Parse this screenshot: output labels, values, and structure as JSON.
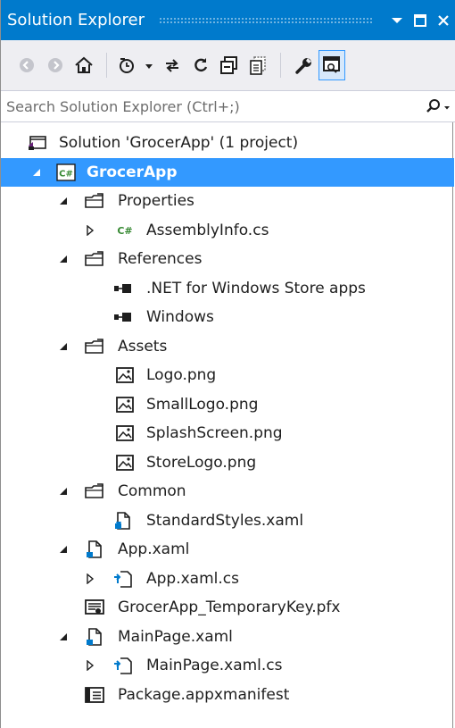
{
  "window": {
    "title": "Solution Explorer",
    "accent": "#007acc",
    "selection_color": "#3399ff"
  },
  "toolbar": {
    "buttons": [
      "back-icon",
      "forward-icon",
      "home-icon",
      "pending-changes-icon",
      "sync-icon",
      "refresh-icon",
      "collapse-all-icon",
      "show-all-files-icon",
      "properties-icon",
      "preview-icon"
    ],
    "dropdown_glyph": "▾"
  },
  "search": {
    "placeholder": "Search Solution Explorer (Ctrl+;)"
  },
  "tree": {
    "solution": "Solution 'GrocerApp' (1 project)",
    "project": "GrocerApp",
    "properties": "Properties",
    "assemblyinfo": "AssemblyInfo.cs",
    "references": "References",
    "ref_netcore": ".NET for Windows Store apps",
    "ref_windows": "Windows",
    "assets": "Assets",
    "logo": "Logo.png",
    "smalllogo": "SmallLogo.png",
    "splash": "SplashScreen.png",
    "storelogo": "StoreLogo.png",
    "common": "Common",
    "standardstyles": "StandardStyles.xaml",
    "appxaml": "App.xaml",
    "appxamlcs": "App.xaml.cs",
    "tempkey": "GrocerApp_TemporaryKey.pfx",
    "mainpage": "MainPage.xaml",
    "mainpagecs": "MainPage.xaml.cs",
    "manifest": "Package.appxmanifest"
  }
}
